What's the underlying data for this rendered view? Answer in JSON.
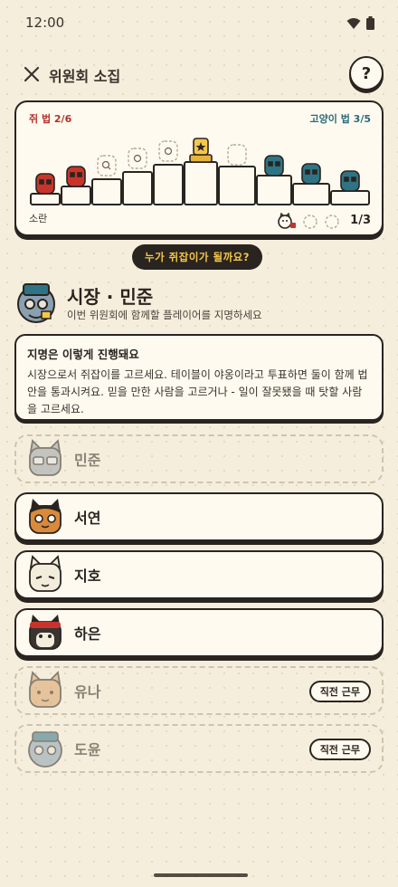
{
  "status_bar": {
    "time": "12:00"
  },
  "top_bar": {
    "title": "위원회 소집",
    "help_label": "?"
  },
  "board": {
    "mouse_law": "쥐 법 2/6",
    "cat_law": "고양이 법 3/5",
    "bottom_left": "소란",
    "counter": "1/3"
  },
  "question_pill": "누가 쥐잡이가 될까요?",
  "mayor": {
    "name": "시장 · 민준",
    "subtitle": "이번 위원회에 함께할 플레이어를 지명하세요"
  },
  "info": {
    "title": "지명은 이렇게 진행돼요",
    "body": "시장으로서 쥐잡이를 고르세요. 테이블이 야옹이라고 투표하면 둘이 함께 법안을 통과시켜요. 믿을 만한 사람을 고르거나 - 일이 잘못됐을 때 탓할 사람을 고르세요."
  },
  "players": [
    {
      "name": "민준",
      "state": "disabled",
      "badge": ""
    },
    {
      "name": "서연",
      "state": "active",
      "badge": ""
    },
    {
      "name": "지호",
      "state": "active",
      "badge": ""
    },
    {
      "name": "하은",
      "state": "active",
      "badge": ""
    },
    {
      "name": "유나",
      "state": "disabled",
      "badge": "직전 근무"
    },
    {
      "name": "도윤",
      "state": "disabled",
      "badge": "직전 근무"
    }
  ],
  "colors": {
    "background": "#f6eedc",
    "ink": "#2a2420",
    "mouse_red": "#b0322a",
    "cat_teal": "#2a6a7a",
    "gold": "#f5c84a"
  }
}
